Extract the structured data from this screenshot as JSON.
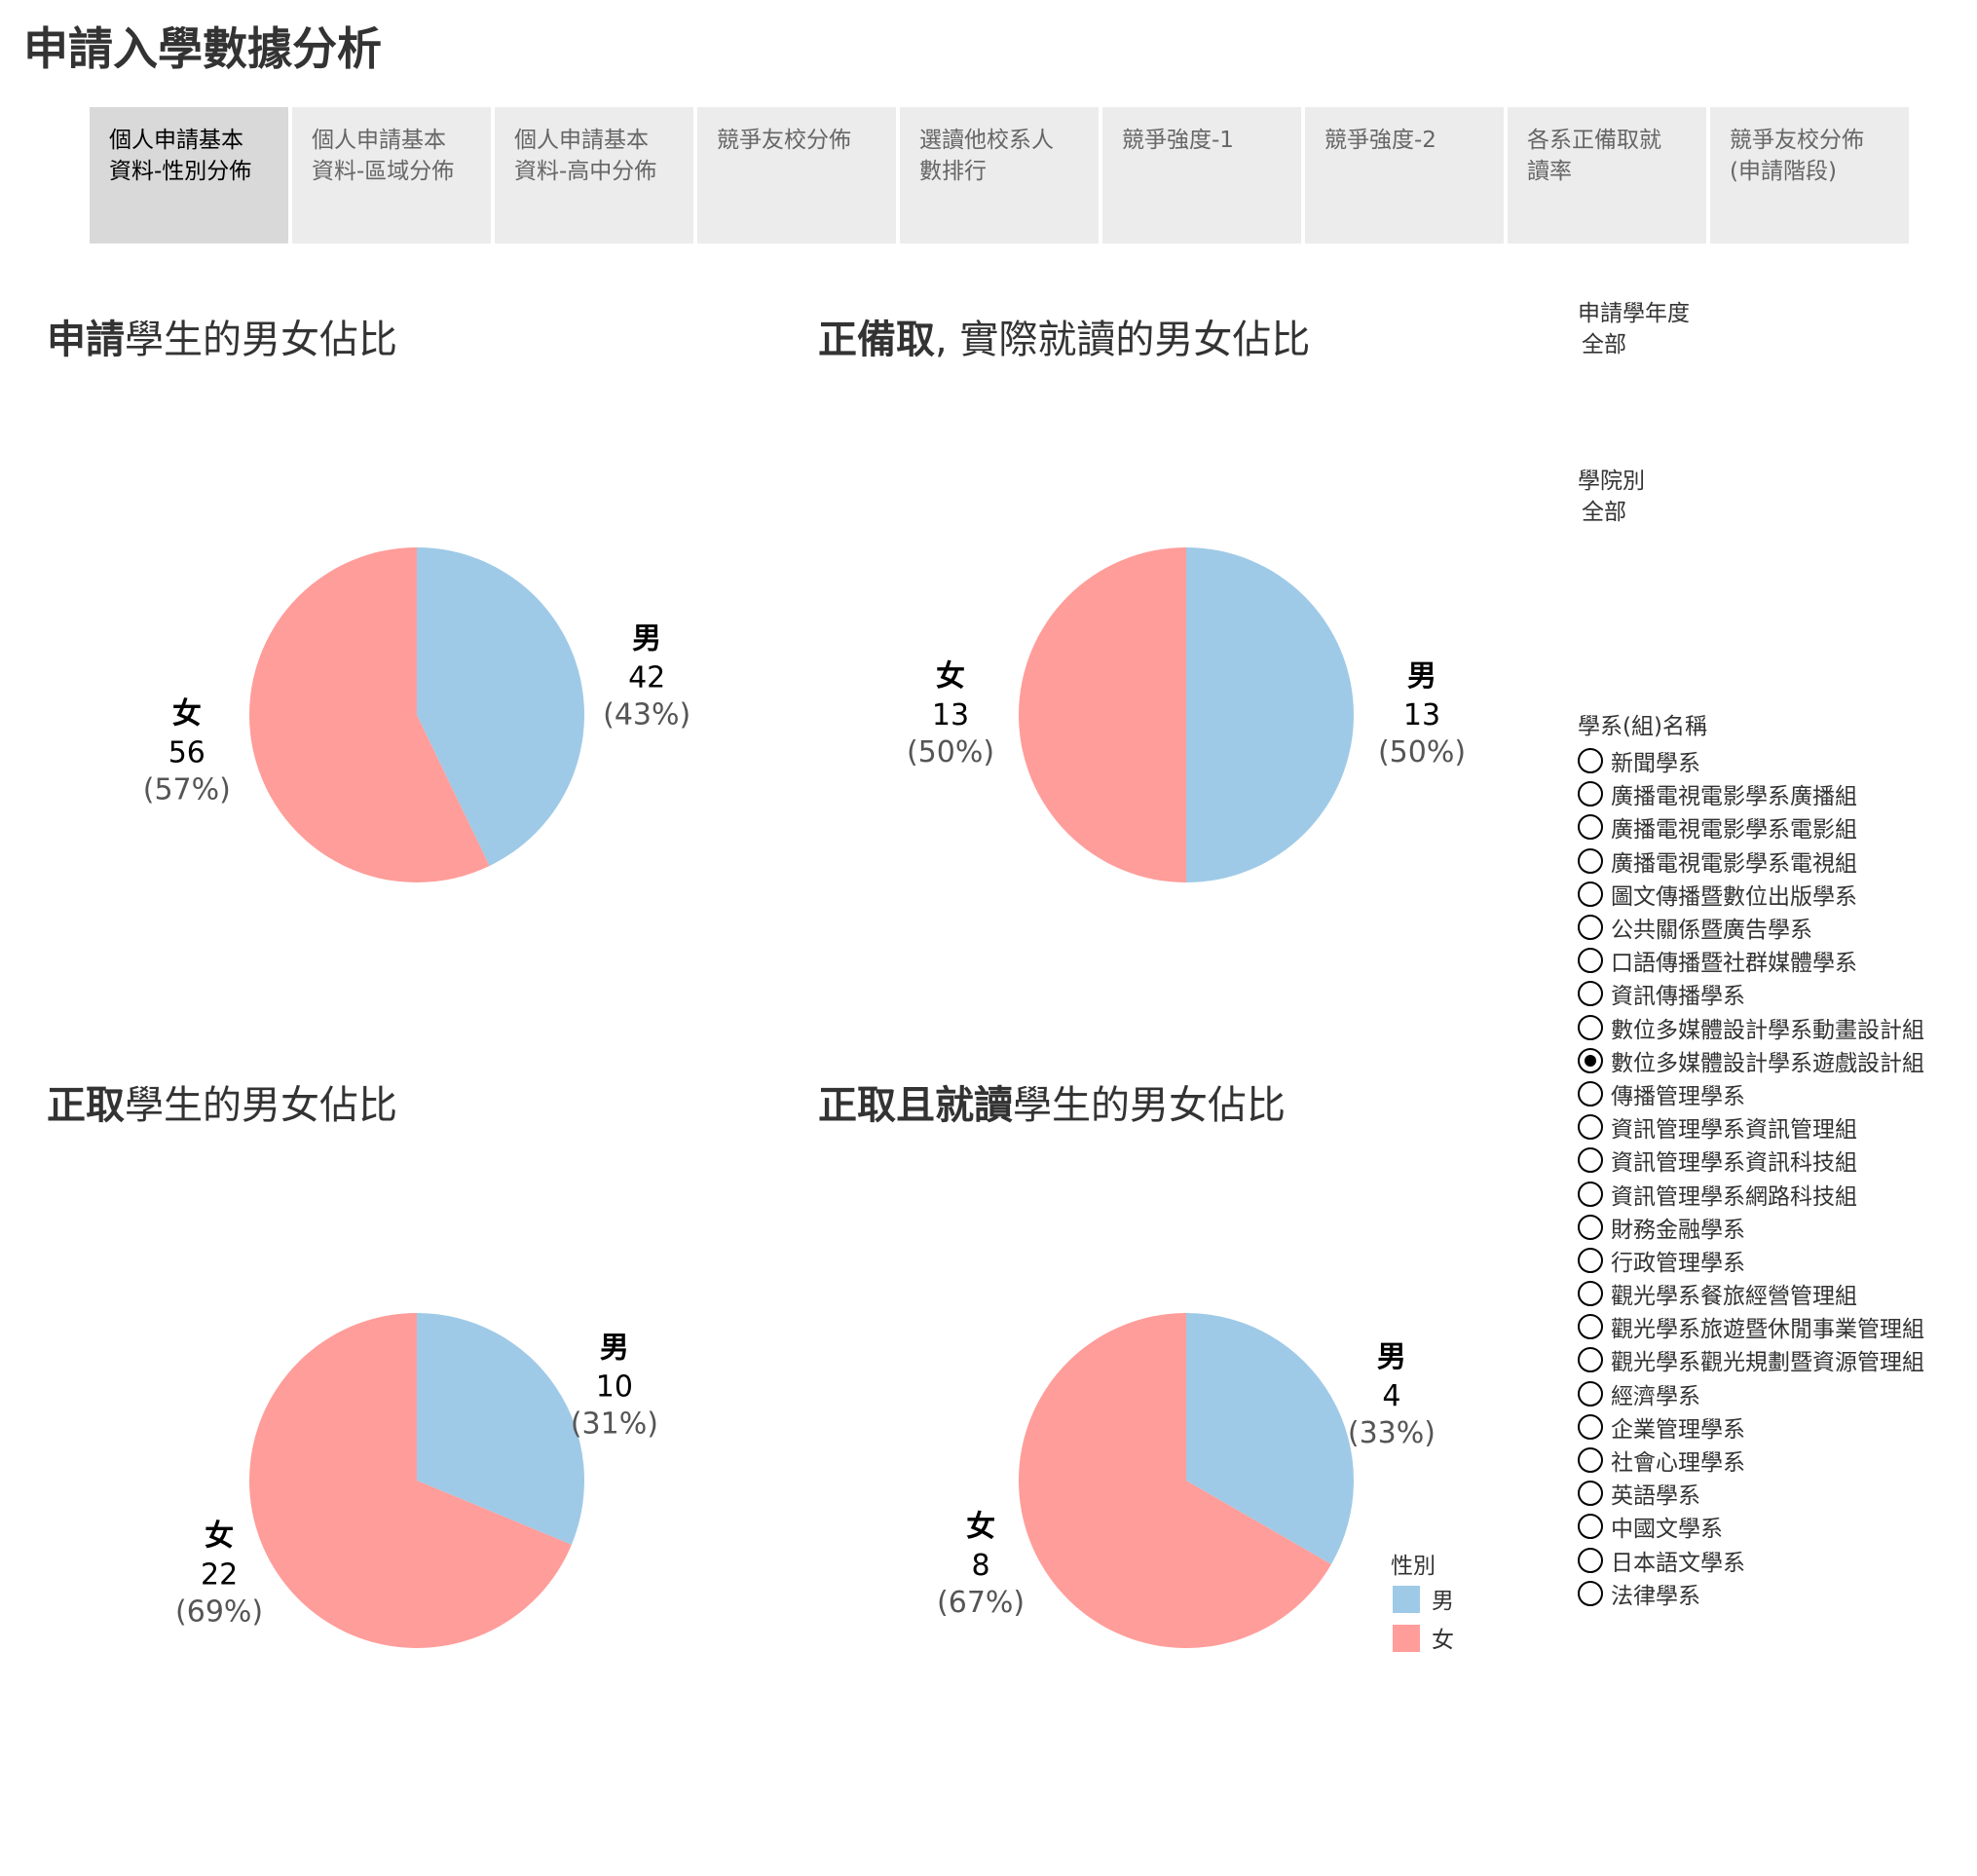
{
  "page": {
    "title": "申請入學數據分析"
  },
  "tabs": [
    {
      "label": "個人申請基本\n資料-性別分佈",
      "active": true
    },
    {
      "label": "個人申請基本\n資料-區域分佈",
      "active": false
    },
    {
      "label": "個人申請基本\n資料-高中分佈",
      "active": false
    },
    {
      "label": "競爭友校分佈",
      "active": false
    },
    {
      "label": "選讀他校系人\n數排行",
      "active": false
    },
    {
      "label": "競爭強度-1",
      "active": false
    },
    {
      "label": "競爭強度-2",
      "active": false
    },
    {
      "label": "各系正備取就\n讀率",
      "active": false
    },
    {
      "label": "競爭友校分佈\n(申請階段)",
      "active": false
    }
  ],
  "titles": {
    "t1": {
      "bold": "申請",
      "rest": "學生的男女佔比"
    },
    "t2": {
      "bold": "正備取",
      "rest": ", 實際就讀的男女佔比"
    },
    "t3": {
      "bold": "正取",
      "rest": "學生的男女佔比"
    },
    "t4": {
      "bold": "正取且就讀",
      "rest": "學生的男女佔比"
    }
  },
  "chart_data": [
    {
      "type": "pie",
      "title": "申請學生的男女佔比",
      "categories": [
        "男",
        "女"
      ],
      "values": [
        42,
        56
      ],
      "value_labels": [
        "42",
        "56"
      ],
      "pct_labels": [
        "(43%)",
        "(57%)"
      ],
      "colors": [
        "#9fcae7",
        "#ff9d9a"
      ]
    },
    {
      "type": "pie",
      "title": "正備取, 實際就讀的男女佔比",
      "categories": [
        "男",
        "女"
      ],
      "values": [
        13,
        13
      ],
      "value_labels": [
        "13",
        "13"
      ],
      "pct_labels": [
        "(50%)",
        "(50%)"
      ],
      "colors": [
        "#9fcae7",
        "#ff9d9a"
      ]
    },
    {
      "type": "pie",
      "title": "正取學生的男女佔比",
      "categories": [
        "男",
        "女"
      ],
      "values": [
        10,
        22
      ],
      "value_labels": [
        "10",
        "22"
      ],
      "pct_labels": [
        "(31%)",
        "(69%)"
      ],
      "colors": [
        "#9fcae7",
        "#ff9d9a"
      ]
    },
    {
      "type": "pie",
      "title": "正取且就讀學生的男女佔比",
      "categories": [
        "男",
        "女"
      ],
      "values": [
        4,
        8
      ],
      "value_labels": [
        "4",
        "8"
      ],
      "pct_labels": [
        "(33%)",
        "(67%)"
      ],
      "colors": [
        "#9fcae7",
        "#ff9d9a"
      ]
    }
  ],
  "legend": {
    "title": "性別",
    "items": [
      {
        "label": "男",
        "color": "#9fcae7"
      },
      {
        "label": "女",
        "color": "#ff9d9a"
      }
    ]
  },
  "filters": {
    "year": {
      "label": "申請學年度",
      "value": "全部"
    },
    "college": {
      "label": "學院別",
      "value": "全部"
    },
    "department": {
      "label": "學系(組)名稱",
      "selected": "數位多媒體設計學系遊戲設計組",
      "options": [
        "新聞學系",
        "廣播電視電影學系廣播組",
        "廣播電視電影學系電影組",
        "廣播電視電影學系電視組",
        "圖文傳播暨數位出版學系",
        "公共關係暨廣告學系",
        "口語傳播暨社群媒體學系",
        "資訊傳播學系",
        "數位多媒體設計學系動畫設計組",
        "數位多媒體設計學系遊戲設計組",
        "傳播管理學系",
        "資訊管理學系資訊管理組",
        "資訊管理學系資訊科技組",
        "資訊管理學系網路科技組",
        "財務金融學系",
        "行政管理學系",
        "觀光學系餐旅經營管理組",
        "觀光學系旅遊暨休閒事業管理組",
        "觀光學系觀光規劃暨資源管理組",
        "經濟學系",
        "企業管理學系",
        "社會心理學系",
        "英語學系",
        "中國文學系",
        "日本語文學系",
        "法律學系"
      ]
    }
  }
}
